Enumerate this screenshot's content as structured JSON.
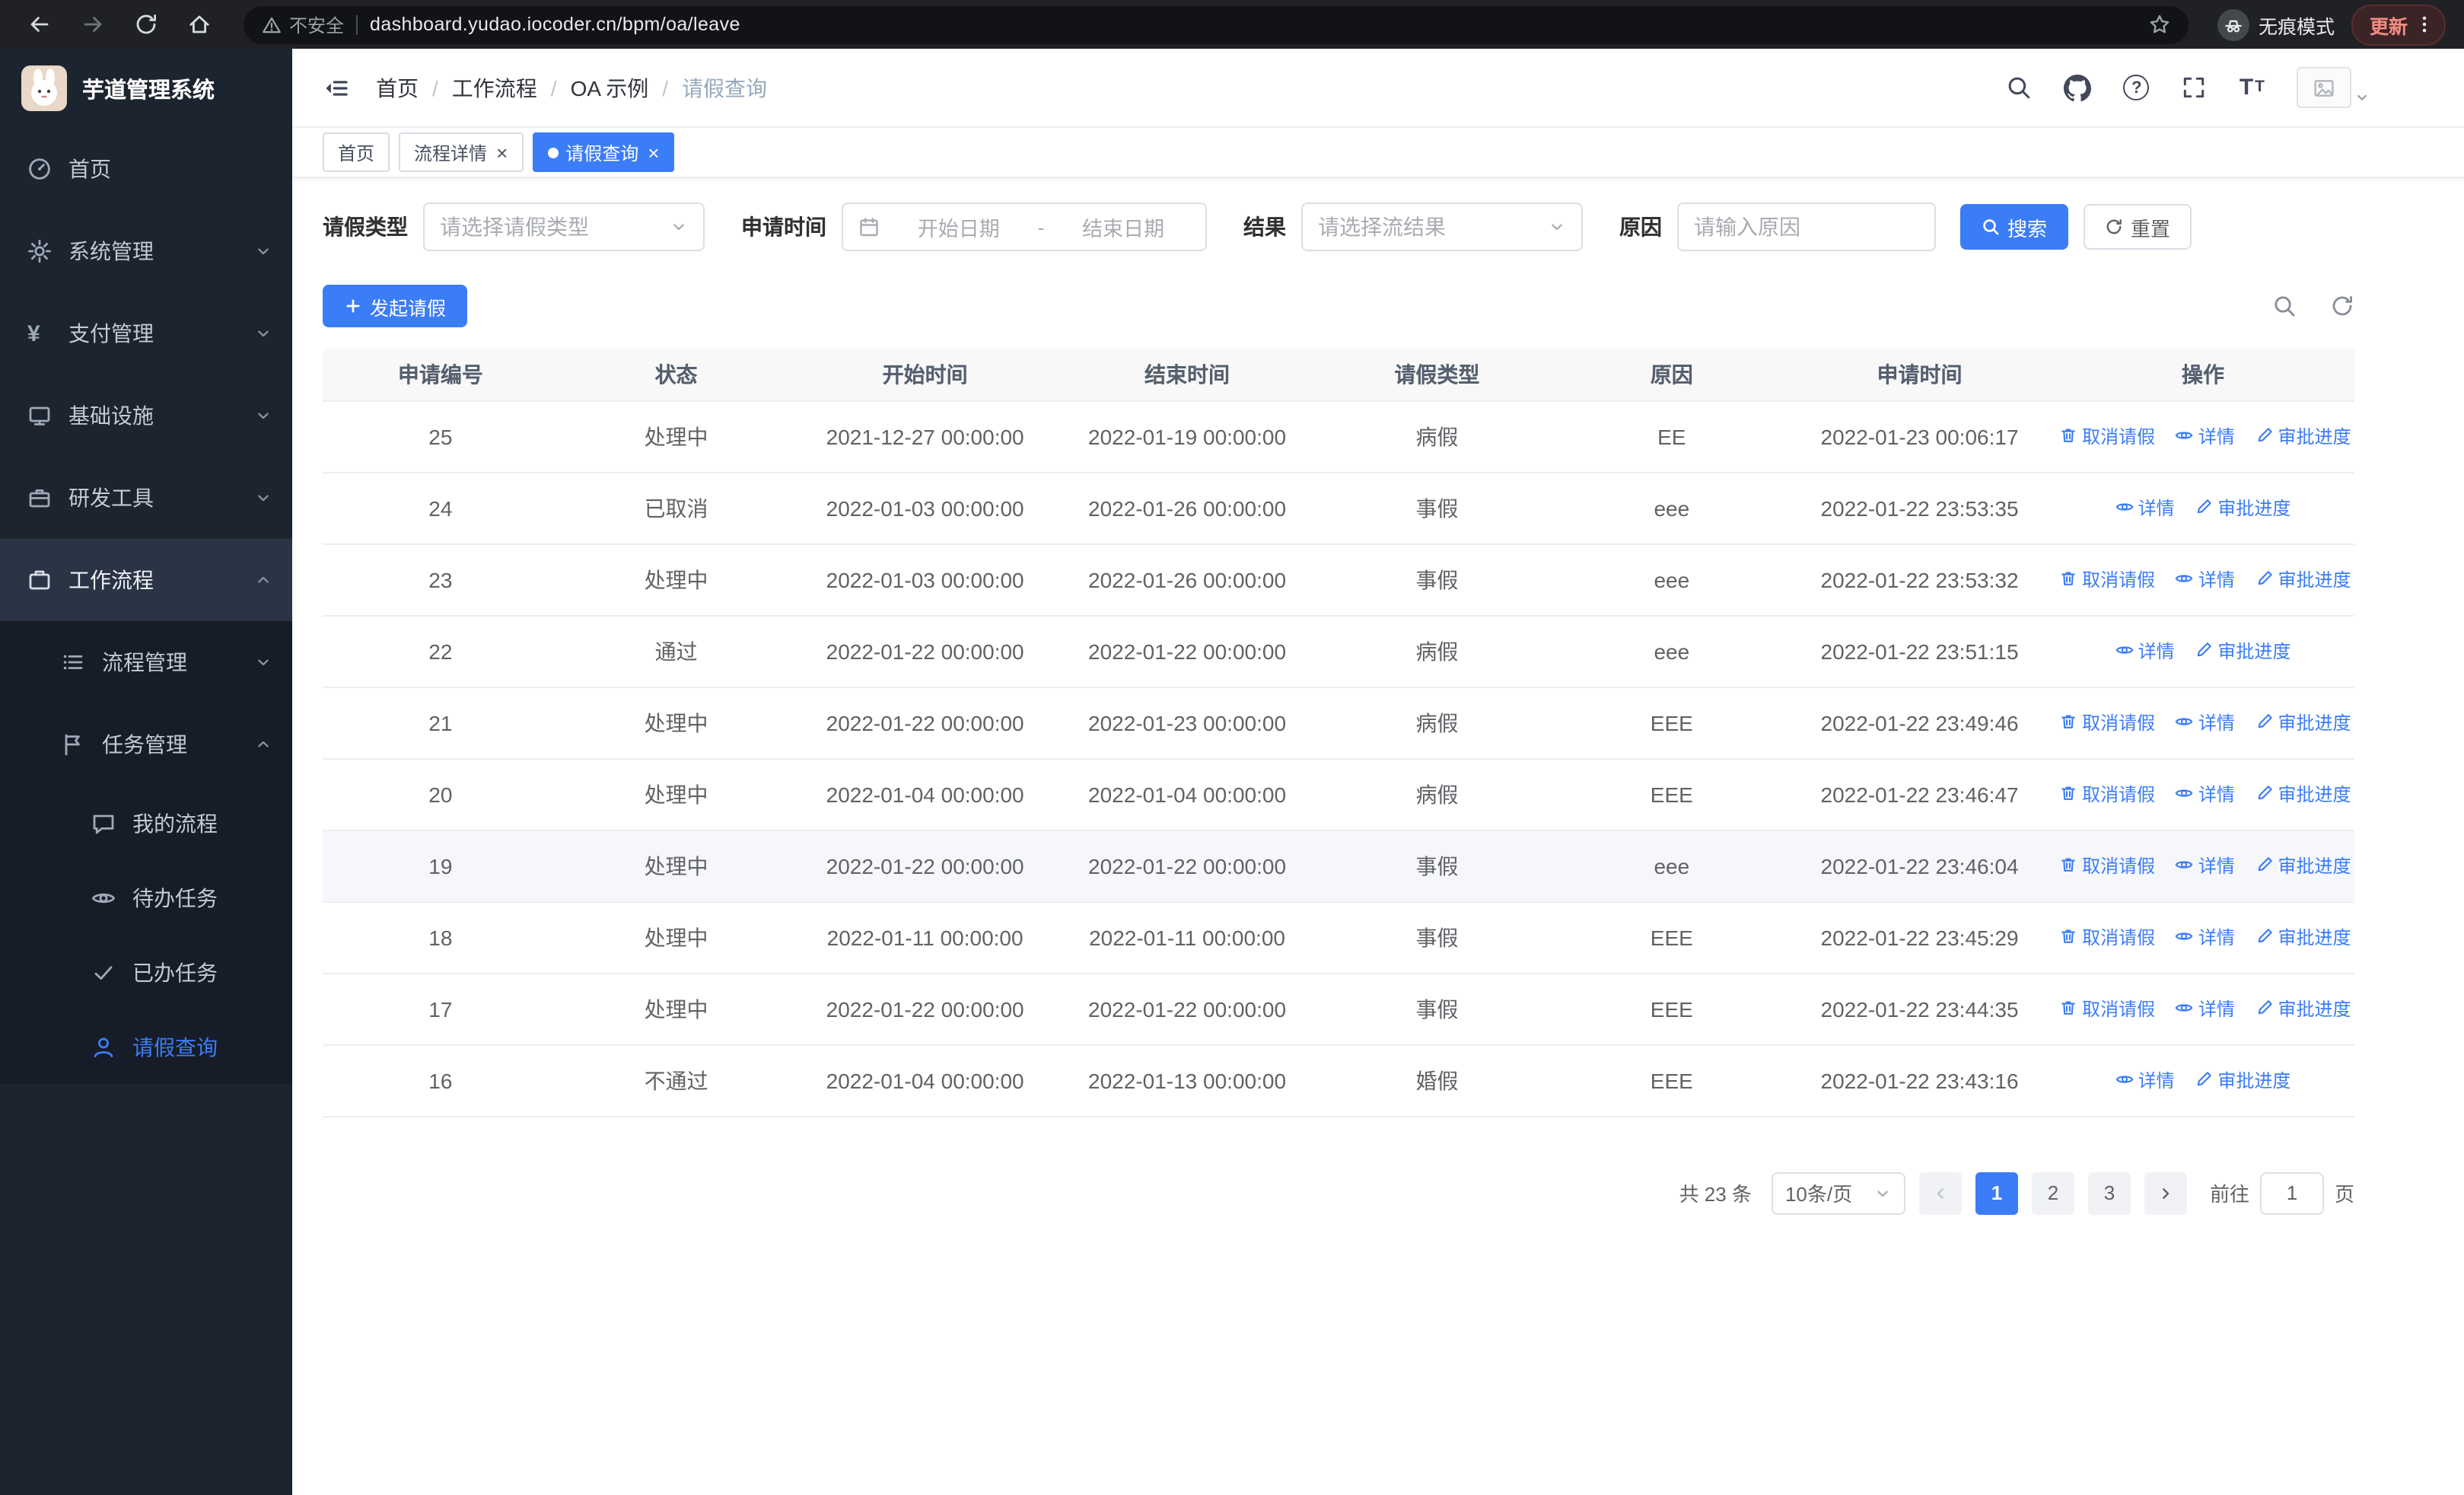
{
  "colors": {
    "accent": "#3b7cf7",
    "side-bg": "#1c2430",
    "side-sub-bg": "#161d28",
    "side-active-bg": "#2a3444",
    "chrome-bg": "#202124",
    "table-head-bg": "#f8f8f9"
  },
  "icons": {
    "close": "×",
    "yen": "¥",
    "question": "?",
    "font_large": "T",
    "font_small": "T"
  },
  "browser": {
    "security_label": "不安全",
    "url": "dashboard.yudao.iocoder.cn/bpm/oa/leave",
    "incognito_label": "无痕模式",
    "update_label": "更新"
  },
  "app": {
    "title": "芋道管理系统"
  },
  "sidebar": {
    "items": [
      {
        "label": "首页"
      },
      {
        "label": "系统管理"
      },
      {
        "label": "支付管理"
      },
      {
        "label": "基础设施"
      },
      {
        "label": "研发工具"
      },
      {
        "label": "工作流程"
      }
    ],
    "workflow_children": [
      {
        "label": "流程管理"
      },
      {
        "label": "任务管理"
      }
    ],
    "task_children": [
      {
        "label": "我的流程"
      },
      {
        "label": "待办任务"
      },
      {
        "label": "已办任务"
      },
      {
        "label": "请假查询"
      }
    ]
  },
  "breadcrumb": {
    "items": [
      "首页",
      "工作流程",
      "OA 示例",
      "请假查询"
    ],
    "separator": "/"
  },
  "tabs": [
    {
      "label": "首页",
      "closable": false,
      "active": false
    },
    {
      "label": "流程详情",
      "closable": true,
      "active": false
    },
    {
      "label": "请假查询",
      "closable": true,
      "active": true
    }
  ],
  "filters": {
    "leave_type_label": "请假类型",
    "leave_type_placeholder": "请选择请假类型",
    "apply_time_label": "申请时间",
    "start_date_placeholder": "开始日期",
    "end_date_placeholder": "结束日期",
    "range_separator": "-",
    "result_label": "结果",
    "result_placeholder": "请选择流结果",
    "reason_label": "原因",
    "reason_placeholder": "请输入原因",
    "search_button": "搜索",
    "reset_button": "重置"
  },
  "toolbar": {
    "create_label": "发起请假"
  },
  "table": {
    "columns": [
      "申请编号",
      "状态",
      "开始时间",
      "结束时间",
      "请假类型",
      "原因",
      "申请时间",
      "操作"
    ],
    "action_labels": {
      "cancel": "取消请假",
      "detail": "详情",
      "progress": "审批进度"
    },
    "rows": [
      {
        "id": "25",
        "status": "处理中",
        "start": "2021-12-27 00:00:00",
        "end": "2022-01-19 00:00:00",
        "type": "病假",
        "reason": "EE",
        "applied": "2022-01-23 00:06:17",
        "cancellable": true,
        "highlight": false
      },
      {
        "id": "24",
        "status": "已取消",
        "start": "2022-01-03 00:00:00",
        "end": "2022-01-26 00:00:00",
        "type": "事假",
        "reason": "eee",
        "applied": "2022-01-22 23:53:35",
        "cancellable": false,
        "highlight": false
      },
      {
        "id": "23",
        "status": "处理中",
        "start": "2022-01-03 00:00:00",
        "end": "2022-01-26 00:00:00",
        "type": "事假",
        "reason": "eee",
        "applied": "2022-01-22 23:53:32",
        "cancellable": true,
        "highlight": false
      },
      {
        "id": "22",
        "status": "通过",
        "start": "2022-01-22 00:00:00",
        "end": "2022-01-22 00:00:00",
        "type": "病假",
        "reason": "eee",
        "applied": "2022-01-22 23:51:15",
        "cancellable": false,
        "highlight": false
      },
      {
        "id": "21",
        "status": "处理中",
        "start": "2022-01-22 00:00:00",
        "end": "2022-01-23 00:00:00",
        "type": "病假",
        "reason": "EEE",
        "applied": "2022-01-22 23:49:46",
        "cancellable": true,
        "highlight": false
      },
      {
        "id": "20",
        "status": "处理中",
        "start": "2022-01-04 00:00:00",
        "end": "2022-01-04 00:00:00",
        "type": "病假",
        "reason": "EEE",
        "applied": "2022-01-22 23:46:47",
        "cancellable": true,
        "highlight": false
      },
      {
        "id": "19",
        "status": "处理中",
        "start": "2022-01-22 00:00:00",
        "end": "2022-01-22 00:00:00",
        "type": "事假",
        "reason": "eee",
        "applied": "2022-01-22 23:46:04",
        "cancellable": true,
        "highlight": true
      },
      {
        "id": "18",
        "status": "处理中",
        "start": "2022-01-11 00:00:00",
        "end": "2022-01-11 00:00:00",
        "type": "事假",
        "reason": "EEE",
        "applied": "2022-01-22 23:45:29",
        "cancellable": true,
        "highlight": false
      },
      {
        "id": "17",
        "status": "处理中",
        "start": "2022-01-22 00:00:00",
        "end": "2022-01-22 00:00:00",
        "type": "事假",
        "reason": "EEE",
        "applied": "2022-01-22 23:44:35",
        "cancellable": true,
        "highlight": false
      },
      {
        "id": "16",
        "status": "不通过",
        "start": "2022-01-04 00:00:00",
        "end": "2022-01-13 00:00:00",
        "type": "婚假",
        "reason": "EEE",
        "applied": "2022-01-22 23:43:16",
        "cancellable": false,
        "highlight": false
      }
    ]
  },
  "pagination": {
    "total": "共 23 条",
    "page_size": "10条/页",
    "pages": [
      "1",
      "2",
      "3"
    ],
    "active_page": "1",
    "goto_label": "前往",
    "goto_value": "1",
    "unit_label": "页"
  }
}
